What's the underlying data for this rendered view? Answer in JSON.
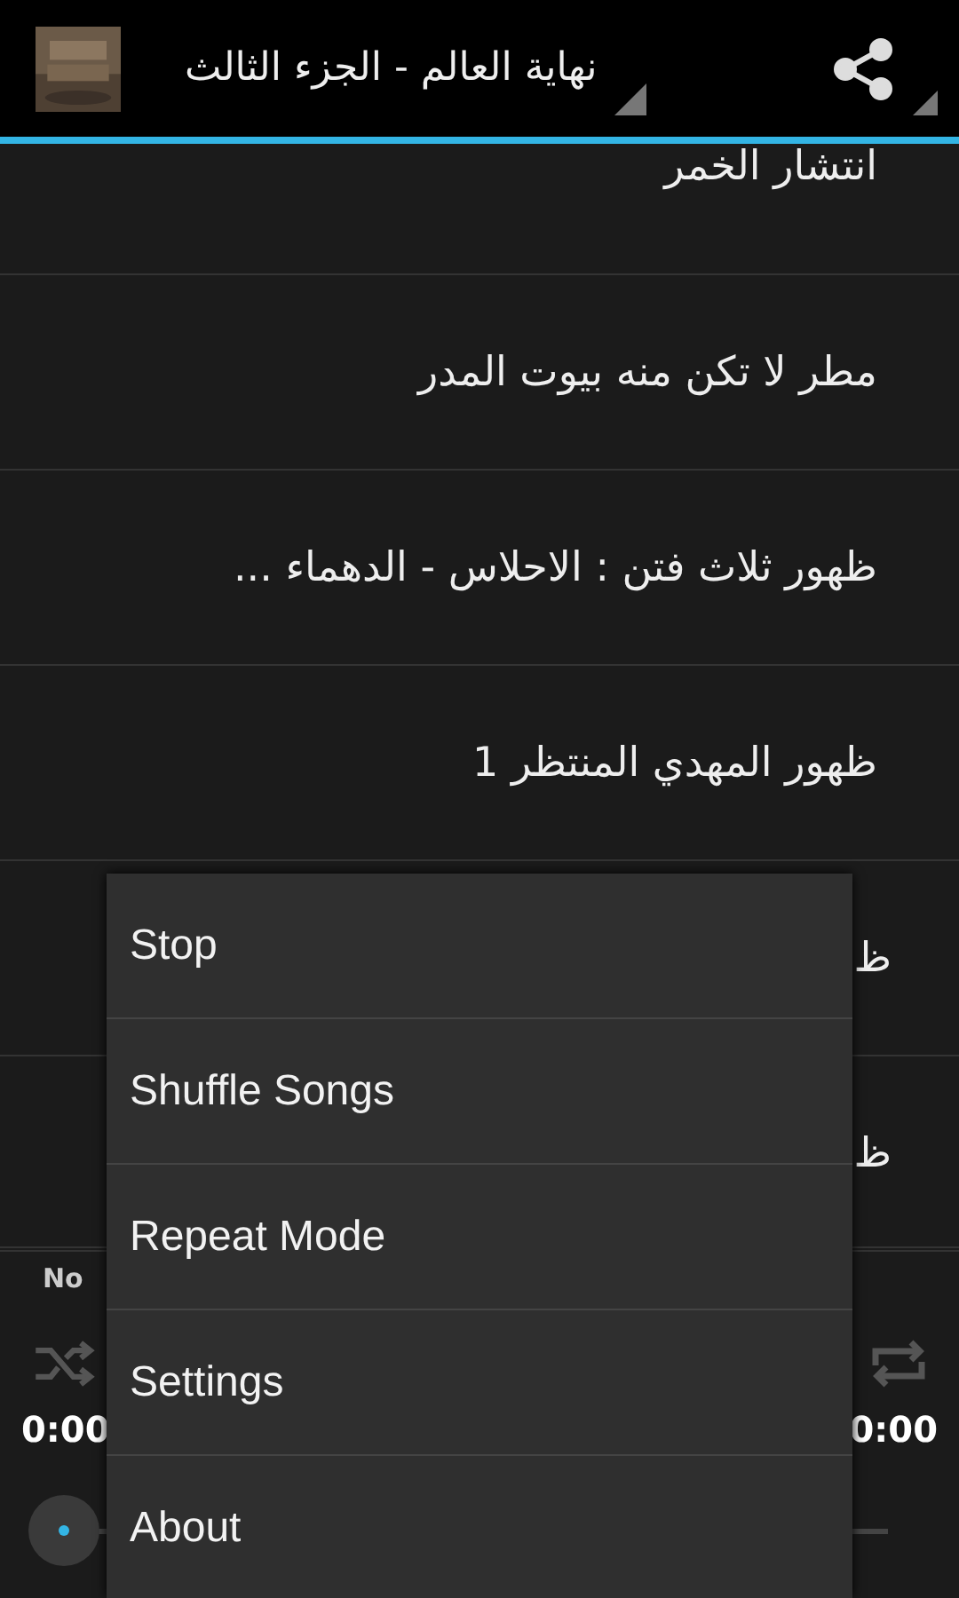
{
  "action_bar": {
    "title": "نهاية العالم - الجزء الثالث"
  },
  "list": [
    {
      "title": "انتشار الخمر",
      "kind": "partial"
    },
    {
      "title": "مطر لا تكن منه بيوت المدر",
      "kind": "full"
    },
    {
      "title": "ظهور ثلاث فتن : الاحلاس - الدهماء ...",
      "kind": "full"
    },
    {
      "title": "ظهور المهدي المنتظر 1",
      "kind": "full"
    },
    {
      "title": "ظ",
      "kind": "covered"
    },
    {
      "title": "ظ",
      "kind": "covered"
    }
  ],
  "player": {
    "track": "No",
    "elapsed": "0:00",
    "total": "0:00"
  },
  "menu": [
    "Stop",
    "Shuffle Songs",
    "Repeat Mode",
    "Settings",
    "About"
  ]
}
